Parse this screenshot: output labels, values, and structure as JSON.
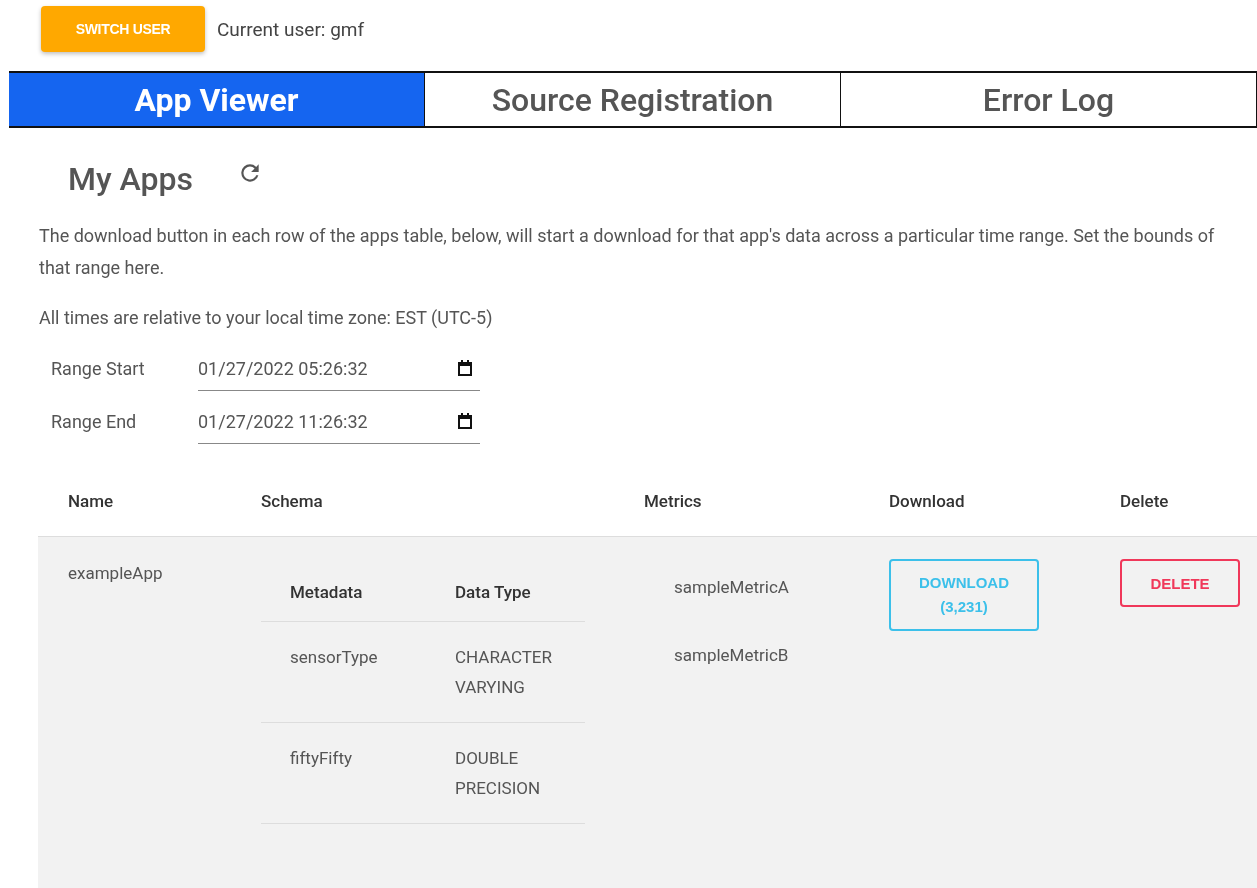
{
  "header": {
    "switch_button": "SWITCH USER",
    "current_user": "Current user: gmf"
  },
  "tabs": [
    {
      "label": "App Viewer",
      "selected": true
    },
    {
      "label": "Source Registration",
      "selected": false
    },
    {
      "label": "Error Log",
      "selected": false
    }
  ],
  "section": {
    "title": "My Apps",
    "description": "The download button in each row of the apps table, below, will start a download for that app's data across a particular time range. Set the bounds of that range here.",
    "timezone_note": "All times are relative to your local time zone: EST (UTC-5)"
  },
  "range_fields": [
    {
      "label": "Range Start",
      "value": "01/27/2022 05:26:32"
    },
    {
      "label": "Range End",
      "value": "01/27/2022 11:26:32"
    }
  ],
  "table": {
    "columns": [
      "Name",
      "Schema",
      "Metrics",
      "Download",
      "Delete"
    ],
    "rows": [
      {
        "name": "exampleApp",
        "schema": {
          "columns": [
            "Metadata",
            "Data Type"
          ],
          "rows": [
            [
              "sensorType",
              "CHARACTER VARYING"
            ],
            [
              "fiftyFifty",
              "DOUBLE PRECISION"
            ]
          ]
        },
        "metrics": [
          "sampleMetricA",
          "sampleMetricB"
        ],
        "download": "DOWNLOAD (3,231)",
        "delete": "DELETE"
      }
    ]
  }
}
